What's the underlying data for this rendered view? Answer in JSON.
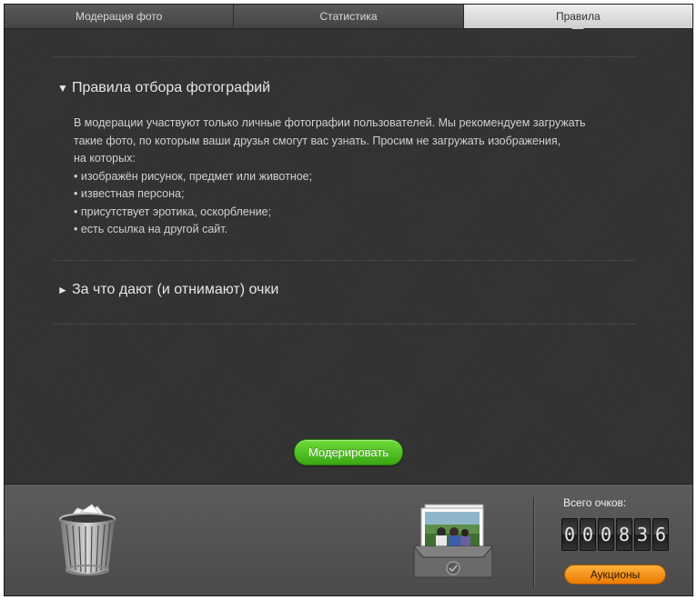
{
  "tabs": [
    {
      "label": "Модерация фото",
      "active": false
    },
    {
      "label": "Статистика",
      "active": false
    },
    {
      "label": "Правила",
      "active": true
    }
  ],
  "sections": [
    {
      "title": "Правила отбора фотографий",
      "expanded": true,
      "lines": [
        "В модерации участвуют только личные фотографии пользователей. Мы рекомендуем загружать",
        "такие фото, по которым ваши друзья смогут вас узнать. Просим не загружать изображения,",
        "на которых:",
        "• изображён рисунок, предмет или животное;",
        "• известная персона;",
        "• присутствует эротика, оскорбление;",
        "• есть ссылка на другой сайт."
      ]
    },
    {
      "title": "За что дают (и отнимают) очки",
      "expanded": false
    }
  ],
  "moderate_button": "Модерировать",
  "score": {
    "label": "Всего очков:",
    "digits": [
      "0",
      "0",
      "0",
      "8",
      "3",
      "6"
    ]
  },
  "auction_button": "Аукционы",
  "colors": {
    "accent_green": "#4cc21f",
    "accent_orange": "#f59411",
    "background": "#333333"
  },
  "icons": {
    "trash": "trash-bin-icon",
    "photo_tray": "photo-tray-icon",
    "expanded": "triangle-down-icon",
    "collapsed": "triangle-right-icon"
  }
}
